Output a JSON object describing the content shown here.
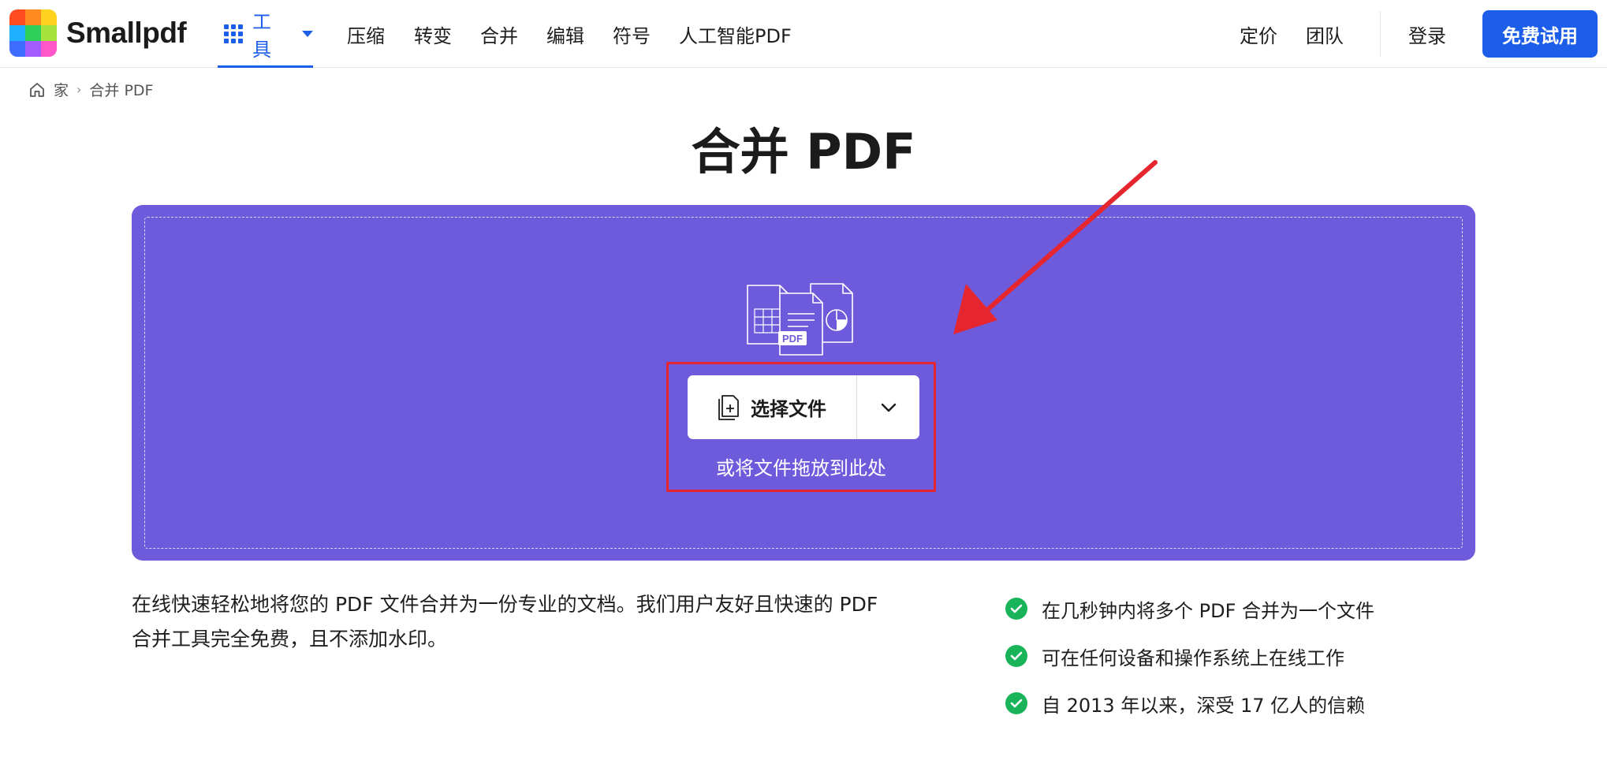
{
  "brand": {
    "name": "Smallpdf",
    "logo_colors": [
      "#ff4d1f",
      "#ff8a1f",
      "#ffd21f",
      "#1fb0ff",
      "#2ecf5a",
      "#a6e23b",
      "#3d6cff",
      "#a35cff",
      "#ff57c9"
    ]
  },
  "nav": {
    "tools_label": "工具",
    "items": [
      "压缩",
      "转变",
      "合并",
      "编辑",
      "符号",
      "人工智能PDF"
    ],
    "right_items": [
      "定价",
      "团队"
    ],
    "login_label": "登录",
    "cta_label": "免费试用"
  },
  "breadcrumb": {
    "home": "家",
    "separator": "›",
    "current": "合并 PDF"
  },
  "page_title": "合并 PDF",
  "dropzone": {
    "illustration_badge": "PDF",
    "choose_label": "选择文件",
    "drop_hint": "或将文件拖放到此处",
    "bg_color": "#6e5bdc"
  },
  "description": "在线快速轻松地将您的 PDF 文件合并为一份专业的文档。我们用户友好且快速的 PDF 合并工具完全免费，且不添加水印。",
  "features": [
    "在几秒钟内将多个 PDF 合并为一个文件",
    "可在任何设备和操作系统上在线工作",
    "自 2013 年以来，深受 17 亿人的信赖"
  ],
  "colors": {
    "accent": "#1c5ee8",
    "check": "#19b35a",
    "annotation": "#e5262e"
  }
}
